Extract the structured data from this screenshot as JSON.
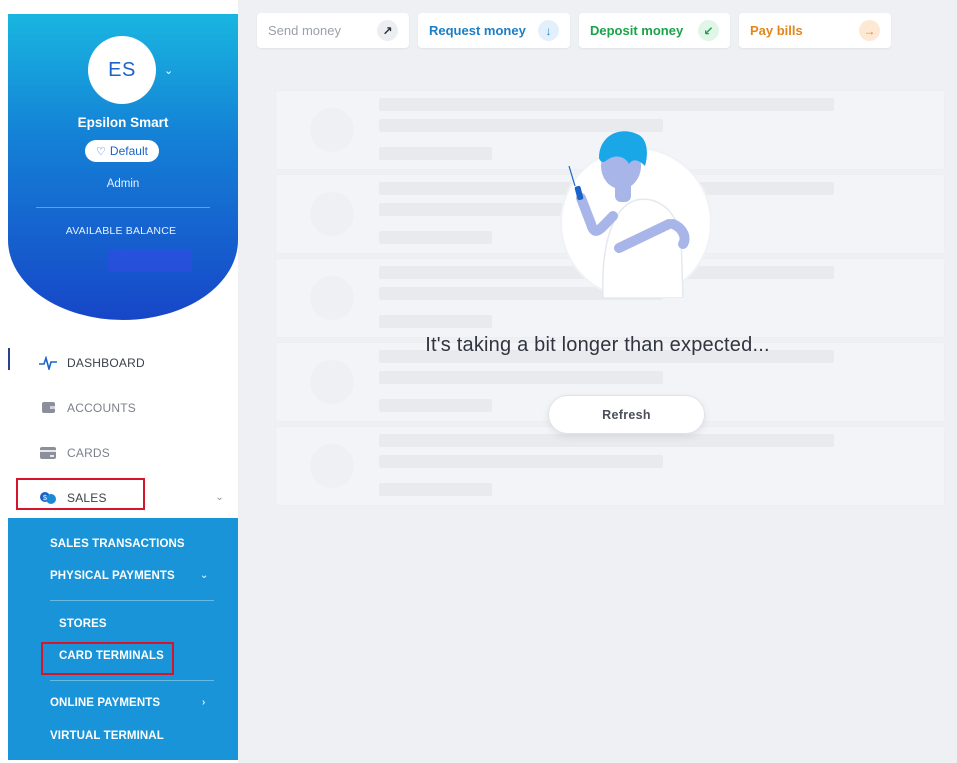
{
  "profile": {
    "initials": "ES",
    "name": "Epsilon Smart",
    "badge": "Default",
    "role": "Admin",
    "balance_label": "AVAILABLE BALANCE"
  },
  "nav": {
    "items": [
      {
        "label": "DASHBOARD",
        "icon": "pulse-icon"
      },
      {
        "label": "ACCOUNTS",
        "icon": "wallet-icon"
      },
      {
        "label": "CARDS",
        "icon": "card-icon"
      },
      {
        "label": "SALES",
        "icon": "sales-chat-icon"
      }
    ],
    "sales_submenu": [
      {
        "label": "SALES TRANSACTIONS"
      },
      {
        "label": "PHYSICAL PAYMENTS"
      },
      {
        "label": "STORES"
      },
      {
        "label": "CARD TERMINALS"
      },
      {
        "label": "ONLINE PAYMENTS"
      },
      {
        "label": "VIRTUAL TERMINAL"
      }
    ]
  },
  "quick_actions": [
    {
      "label": "Send money",
      "icon": "arrow-up-right-icon",
      "glyph": "↗",
      "color": "#9aa0ab"
    },
    {
      "label": "Request money",
      "icon": "arrow-down-icon",
      "glyph": "↓",
      "color": "#1a7fc7"
    },
    {
      "label": "Deposit money",
      "icon": "arrow-down-left-icon",
      "glyph": "↙",
      "color": "#1aa34a"
    },
    {
      "label": "Pay bills",
      "icon": "arrow-right-icon",
      "glyph": "→",
      "color": "#e2861c"
    }
  ],
  "status": {
    "message": "It's taking a bit longer than expected...",
    "refresh_label": "Refresh"
  },
  "colors": {
    "accent_blue": "#1a94d8",
    "highlight_red": "#d3162b"
  }
}
